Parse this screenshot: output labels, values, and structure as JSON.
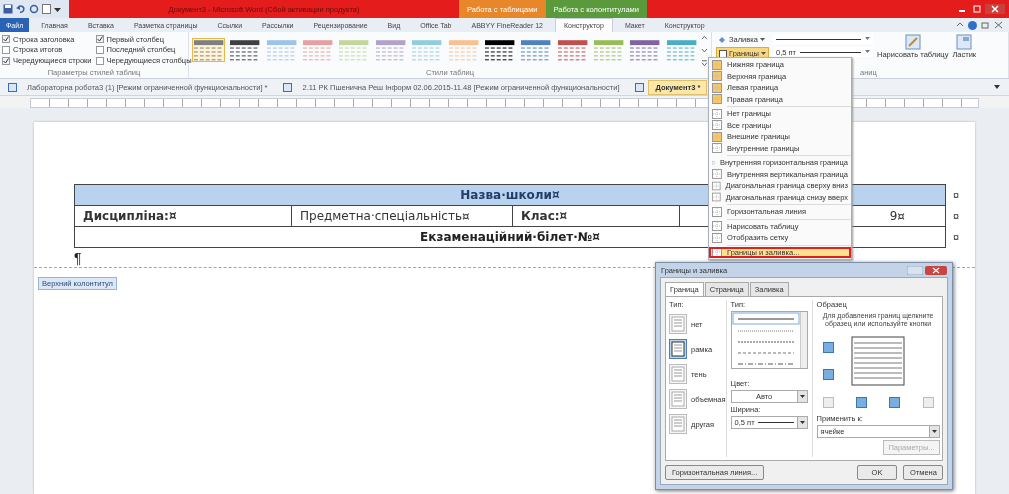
{
  "title_bar": {
    "title": "Документ3 - Microsoft Word (Сбой активации продукта)",
    "context_tabs": [
      {
        "label": "Работа с таблицами",
        "color": "#e8862a"
      },
      {
        "label": "Работа с колонтитулами",
        "color": "#5a9a3c"
      }
    ]
  },
  "ribbon_tabs": [
    {
      "label": "Файл",
      "kind": "file",
      "selected": false
    },
    {
      "label": "Главная",
      "kind": "tab",
      "selected": false
    },
    {
      "label": "Вставка",
      "kind": "tab",
      "selected": false
    },
    {
      "label": "Разметка страницы",
      "kind": "tab",
      "selected": false
    },
    {
      "label": "Ссылки",
      "kind": "tab",
      "selected": false
    },
    {
      "label": "Рассылки",
      "kind": "tab",
      "selected": false
    },
    {
      "label": "Рецензирование",
      "kind": "tab",
      "selected": false
    },
    {
      "label": "Вид",
      "kind": "tab",
      "selected": false
    },
    {
      "label": "Office Tab",
      "kind": "tab",
      "selected": false
    },
    {
      "label": "ABBYY FineReader 12",
      "kind": "tab",
      "selected": false
    },
    {
      "label": "Конструктор",
      "kind": "tab",
      "selected": true
    },
    {
      "label": "Макет",
      "kind": "tab",
      "selected": false
    },
    {
      "label": "Конструктор",
      "kind": "tab",
      "selected": false
    }
  ],
  "style_options": {
    "label": "Параметры стилей таблиц",
    "items": [
      {
        "label": "Строка заголовка",
        "checked": true
      },
      {
        "label": "Строка итогов",
        "checked": false
      },
      {
        "label": "Чередующиеся строки",
        "checked": true
      },
      {
        "label": "Первый столбец",
        "checked": true
      },
      {
        "label": "Последний столбец",
        "checked": false
      },
      {
        "label": "Чередующиеся столбцы",
        "checked": false
      }
    ]
  },
  "table_styles": {
    "label": "Стили таблиц",
    "swatches": [
      {
        "color": "#7f7f7f",
        "selected": true
      },
      {
        "color": "#404040",
        "selected": false
      },
      {
        "color": "#9dc3e6",
        "selected": false
      },
      {
        "color": "#e6a0a0",
        "selected": false
      },
      {
        "color": "#c3d69b",
        "selected": false
      },
      {
        "color": "#b3a2c7",
        "selected": false
      },
      {
        "color": "#92cddc",
        "selected": false
      },
      {
        "color": "#fac090",
        "selected": false
      },
      {
        "color": "#000000",
        "selected": false
      },
      {
        "color": "#4f81bd",
        "selected": false
      },
      {
        "color": "#c0504d",
        "selected": false
      },
      {
        "color": "#9bbb59",
        "selected": false
      },
      {
        "color": "#8064a2",
        "selected": false
      },
      {
        "color": "#4bacc6",
        "selected": false
      }
    ]
  },
  "borders_group": {
    "shading": "Заливка",
    "borders": "Границы",
    "line_width": "0,5 пт",
    "draw_table": "Нарисовать таблицу",
    "eraser": "Ластик",
    "label": "аниц"
  },
  "doc_tabs": [
    {
      "label": "Лабораторна робота3 (1) [Режим ограниченной функциональности] *",
      "selected": false
    },
    {
      "label": "2.11 РК Пшенична Реш Інформ 02.06.2015-11.48   [Режим ограниченной функциональности]",
      "selected": false
    },
    {
      "label": "Документ3 *",
      "selected": true
    }
  ],
  "document": {
    "table": {
      "rows": [
        {
          "kind": "header",
          "cells": [
            "Назва·школи¤"
          ],
          "end": "¤"
        },
        {
          "kind": "fields",
          "cells": [
            "Дисципліна:¤",
            "Предметна·спеціальність¤",
            "Клас:¤",
            "9¤"
          ],
          "end": "¤"
        },
        {
          "kind": "title",
          "cells": [
            "Екзаменаційний·білет·№¤"
          ],
          "end": "¤"
        }
      ]
    },
    "paragraph_mark": "¶",
    "header_label": "Верхний колонтитул"
  },
  "borders_menu": {
    "groups": [
      [
        {
          "label": "Нижняя граница",
          "checked": true,
          "selected": false
        },
        {
          "label": "Верхняя граница",
          "checked": true,
          "selected": false
        },
        {
          "label": "Левая граница",
          "checked": true,
          "selected": false
        },
        {
          "label": "Правая граница",
          "checked": true,
          "selected": false
        }
      ],
      [
        {
          "label": "Нет границы",
          "checked": false,
          "selected": false
        },
        {
          "label": "Все границы",
          "checked": false,
          "selected": false
        },
        {
          "label": "Внешние границы",
          "checked": true,
          "selected": false
        },
        {
          "label": "Внутренние границы",
          "checked": false,
          "selected": false
        }
      ],
      [
        {
          "label": "Внутренняя горизонтальная граница",
          "checked": false,
          "selected": false
        },
        {
          "label": "Внутренняя вертикальная граница",
          "checked": false,
          "selected": false
        },
        {
          "label": "Диагональная граница сверху вниз",
          "checked": false,
          "selected": false
        },
        {
          "label": "Диагональная граница снизу вверх",
          "checked": false,
          "selected": false
        }
      ],
      [
        {
          "label": "Горизонтальная линия",
          "checked": false,
          "selected": false
        }
      ],
      [
        {
          "label": "Нарисовать таблицу",
          "checked": false,
          "selected": false
        },
        {
          "label": "Отобразить сетку",
          "checked": false,
          "selected": false
        }
      ],
      [
        {
          "label": "Границы и заливка...",
          "checked": false,
          "selected": true
        }
      ]
    ]
  },
  "dialog": {
    "title": "Границы и заливка",
    "tabs": [
      {
        "label": "Граница",
        "selected": true
      },
      {
        "label": "Страница",
        "selected": false
      },
      {
        "label": "Заливка",
        "selected": false
      }
    ],
    "type_label": "Тип:",
    "types": [
      {
        "label": "нет",
        "selected": false
      },
      {
        "label": "рамка",
        "selected": true
      },
      {
        "label": "тень",
        "selected": false
      },
      {
        "label": "объемная",
        "selected": false
      },
      {
        "label": "другая",
        "selected": false
      }
    ],
    "style_label": "Тип:",
    "color_label": "Цвет:",
    "colour_setting": "Авто",
    "width_label": "Ширина:",
    "width": "0,5 пт",
    "sample_label": "Образец",
    "sample_hint": "Для добавления границ щелкните образец или используйте кнопки",
    "apply_label": "Применить к:",
    "apply": "ячейке",
    "options": {
      "label": "Параметры...",
      "disabled": true
    },
    "horizontal_line": "Горизонтальная линия...",
    "ok": "OK",
    "cancel": "Отмена"
  }
}
